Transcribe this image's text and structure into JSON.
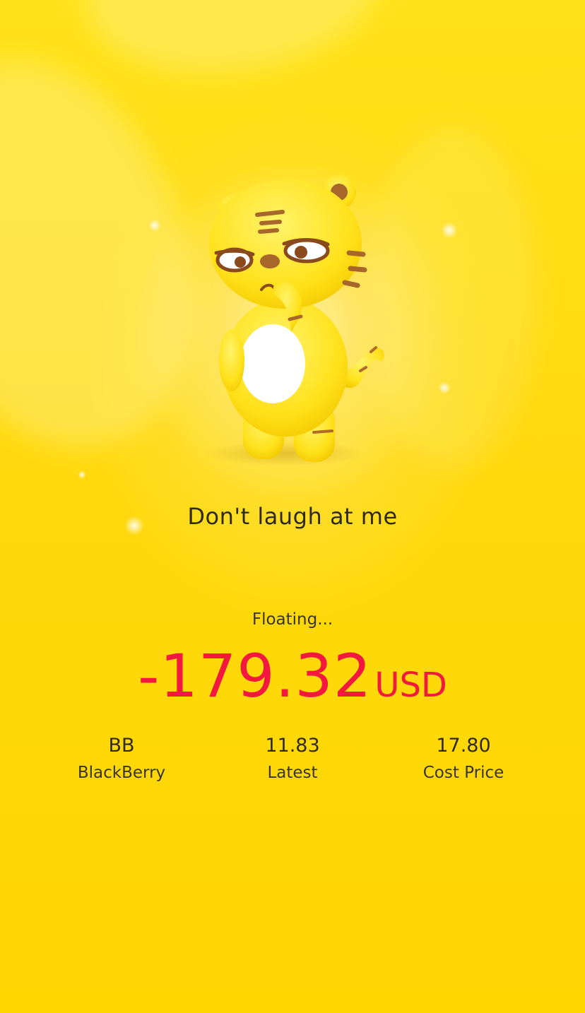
{
  "caption": "Don't laugh at me",
  "floating_label": "Floating...",
  "amount": {
    "value": "-179.32",
    "currency": "USD",
    "color": "#F2183F"
  },
  "stats": [
    {
      "value": "BB",
      "label": "BlackBerry"
    },
    {
      "value": "11.83",
      "label": "Latest"
    },
    {
      "value": "17.80",
      "label": "Cost Price"
    }
  ],
  "colors": {
    "background": "#FFD90F",
    "text": "#2F2A1C"
  },
  "mascot": {
    "icon": "tiger-mascot-icon"
  }
}
